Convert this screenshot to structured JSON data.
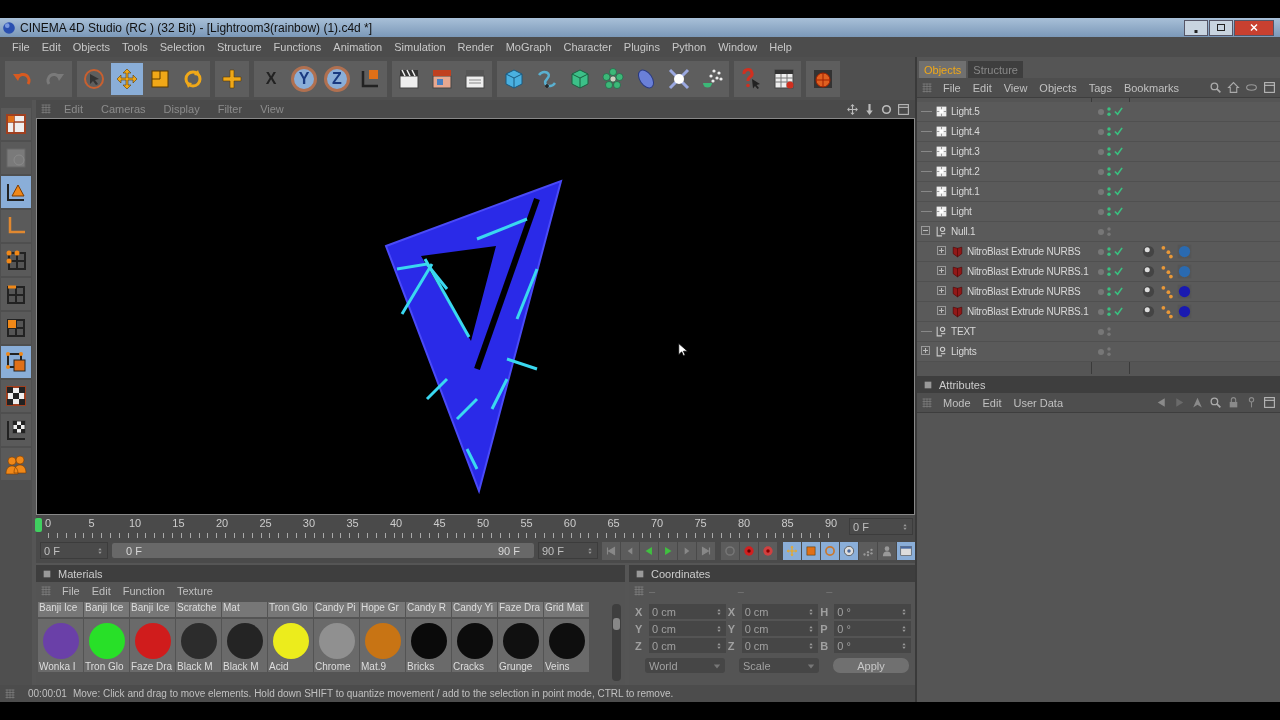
{
  "window": {
    "title": "CINEMA 4D Studio (RC ) (32 Bit) - [Lightroom3(rainbow) (1).c4d *]"
  },
  "menu_bar": [
    "File",
    "Edit",
    "Objects",
    "Tools",
    "Selection",
    "Structure",
    "Functions",
    "Animation",
    "Simulation",
    "Render",
    "MoGraph",
    "Character",
    "Plugins",
    "Python",
    "Window",
    "Help"
  ],
  "toolbar": [
    [
      {
        "kind": "undo",
        "selected": false
      },
      {
        "kind": "redo",
        "selected": false
      }
    ],
    [
      {
        "kind": "select",
        "selected": false
      },
      {
        "kind": "move",
        "selected": true
      },
      {
        "kind": "scale",
        "selected": false
      },
      {
        "kind": "rotate",
        "selected": false
      }
    ],
    [
      {
        "kind": "add",
        "selected": false
      }
    ],
    [
      {
        "kind": "axis",
        "label": "X",
        "selected": false
      },
      {
        "kind": "axis",
        "label": "Y",
        "selected": true
      },
      {
        "kind": "axis",
        "label": "Z",
        "selected": true
      },
      {
        "kind": "coord",
        "selected": false
      }
    ],
    [
      {
        "kind": "render-view",
        "selected": false
      },
      {
        "kind": "render",
        "selected": false
      },
      {
        "kind": "render-settings",
        "selected": false
      }
    ],
    [
      {
        "kind": "cube",
        "selected": false
      },
      {
        "kind": "spline",
        "selected": false
      },
      {
        "kind": "nurbs",
        "selected": false
      },
      {
        "kind": "array",
        "selected": false
      },
      {
        "kind": "deformer",
        "selected": false
      },
      {
        "kind": "scene",
        "selected": false
      },
      {
        "kind": "particles",
        "selected": false
      }
    ],
    [
      {
        "kind": "help",
        "selected": false
      },
      {
        "kind": "table",
        "selected": false
      }
    ],
    [
      {
        "kind": "sphere",
        "selected": false
      }
    ]
  ],
  "left_palette": [
    {
      "kind": "layout",
      "selected": false
    },
    {
      "kind": "texture",
      "selected": false
    },
    {
      "kind": "model",
      "selected": true
    },
    {
      "kind": "object-axis",
      "selected": false
    },
    {
      "kind": "points",
      "selected": false
    },
    {
      "kind": "edges",
      "selected": false
    },
    {
      "kind": "polygons",
      "selected": false
    },
    {
      "kind": "uv-polygons",
      "selected": true
    },
    {
      "kind": "checker",
      "selected": false
    },
    {
      "kind": "axis-checker",
      "selected": false
    },
    {
      "kind": "bodies",
      "selected": false
    }
  ],
  "viewport": {
    "menu": [
      "Edit",
      "Cameras",
      "Display",
      "Filter",
      "View"
    ]
  },
  "timeline": {
    "ticks": [
      "0",
      "5",
      "10",
      "15",
      "20",
      "25",
      "30",
      "35",
      "40",
      "45",
      "50",
      "55",
      "60",
      "65",
      "70",
      "75",
      "80",
      "85",
      "90"
    ],
    "current_frame": "0 F",
    "start": "0 F",
    "range": {
      "start": "0 F",
      "end": "90 F",
      "level": 1
    },
    "end": "90 F",
    "controls": [
      {
        "kind": "first",
        "selected": false
      },
      {
        "kind": "prev",
        "selected": false
      },
      {
        "kind": "play-back",
        "selected": false
      },
      {
        "kind": "play",
        "selected": false
      },
      {
        "kind": "next",
        "selected": false
      },
      {
        "kind": "last",
        "selected": false
      },
      {
        "kind": "key-off",
        "selected": false
      },
      {
        "kind": "record",
        "selected": false
      },
      {
        "kind": "autokey",
        "selected": false
      },
      {
        "kind": "key-move",
        "selected": true
      },
      {
        "kind": "key-scale",
        "selected": true
      },
      {
        "kind": "key-rotate",
        "selected": true
      },
      {
        "kind": "key-param",
        "selected": true
      },
      {
        "kind": "point-level",
        "selected": false
      },
      {
        "kind": "pla",
        "selected": false
      },
      {
        "kind": "scheme",
        "selected": true
      }
    ]
  },
  "materials": {
    "title": "Materials",
    "menu": [
      "File",
      "Edit",
      "Function",
      "Texture"
    ],
    "top_labels": [
      "Banji Ice",
      "Banji Ice",
      "Banji Ice",
      "Scratche",
      "Mat",
      "Tron Glo",
      "Candy Pi",
      "Hope Gr",
      "Candy R",
      "Candy Yi",
      "Faze Dra",
      "Grid Mat"
    ],
    "items": [
      {
        "name": "Wonka I",
        "color": "#6a40a8"
      },
      {
        "name": "Tron Glo",
        "color": "#28e028"
      },
      {
        "name": "Faze Dra",
        "color": "#d01c1c"
      },
      {
        "name": "Black M",
        "color": "#2c2c2c"
      },
      {
        "name": "Black M",
        "color": "#242424"
      },
      {
        "name": "Acid",
        "color": "#ecec1c"
      },
      {
        "name": "Chrome",
        "color": "#909090"
      },
      {
        "name": "Mat.9",
        "color": "#c87414"
      },
      {
        "name": "Bricks",
        "color": "#0a0a0a"
      },
      {
        "name": "Cracks",
        "color": "#0c0c0c"
      },
      {
        "name": "Grunge",
        "color": "#101010"
      },
      {
        "name": "Veins",
        "color": "#0e0e0e"
      }
    ]
  },
  "coordinates": {
    "title": "Coordinates",
    "menu": [
      "–",
      "–",
      "–"
    ],
    "disabled": true,
    "rows": [
      {
        "position_axis": "X",
        "position": "0 cm",
        "size_axis": "X",
        "size": "0 cm",
        "rotation_axis": "H",
        "rotation": "0 °"
      },
      {
        "position_axis": "Y",
        "position": "0 cm",
        "size_axis": "Y",
        "size": "0 cm",
        "rotation_axis": "P",
        "rotation": "0 °"
      },
      {
        "position_axis": "Z",
        "position": "0 cm",
        "size_axis": "Z",
        "size": "0 cm",
        "rotation_axis": "B",
        "rotation": "0 °"
      }
    ],
    "dropdowns": [
      "World",
      "Scale"
    ],
    "apply": "Apply"
  },
  "status_bar": {
    "time": "00:00:01",
    "message": "Move: Click and drag to move elements. Hold down SHIFT to quantize movement / add to the selection in point mode, CTRL to remove."
  },
  "objects": {
    "tabs": [
      {
        "label": "Objects",
        "selected": true
      },
      {
        "label": "Structure",
        "selected": false
      }
    ],
    "menu": [
      "File",
      "Edit",
      "View",
      "Objects",
      "Tags",
      "Bookmarks"
    ],
    "tree": [
      {
        "name": "Light.5",
        "kind": "light",
        "enabled": true
      },
      {
        "name": "Light.4",
        "kind": "light",
        "enabled": true
      },
      {
        "name": "Light.3",
        "kind": "light",
        "enabled": true
      },
      {
        "name": "Light.2",
        "kind": "light",
        "enabled": true
      },
      {
        "name": "Light.1",
        "kind": "light",
        "enabled": true
      },
      {
        "name": "Light",
        "kind": "light",
        "enabled": true
      },
      {
        "name": "Null.1",
        "kind": "null",
        "enabled": false,
        "expanded": true,
        "children": [
          {
            "name": "NitroBlast Extrude NURBS",
            "kind": "extrude",
            "enabled": true,
            "expanded": false,
            "tags": [
              {
                "kind": "phong"
              },
              {
                "kind": "points"
              },
              {
                "kind": "material",
                "color": "#2a6ab0"
              }
            ]
          },
          {
            "name": "NitroBlast Extrude NURBS.1",
            "kind": "extrude",
            "enabled": true,
            "expanded": false,
            "tags": [
              {
                "kind": "phong"
              },
              {
                "kind": "points"
              },
              {
                "kind": "material",
                "color": "#2a6ab0"
              }
            ]
          },
          {
            "name": "NitroBlast Extrude NURBS",
            "kind": "extrude",
            "enabled": true,
            "expanded": false,
            "tags": [
              {
                "kind": "phong"
              },
              {
                "kind": "points"
              },
              {
                "kind": "material",
                "color": "#1a1ab0"
              }
            ]
          },
          {
            "name": "NitroBlast Extrude NURBS.1",
            "kind": "extrude",
            "enabled": true,
            "expanded": false,
            "tags": [
              {
                "kind": "phong"
              },
              {
                "kind": "points"
              },
              {
                "kind": "material",
                "color": "#1a1ab0"
              }
            ]
          }
        ]
      },
      {
        "name": "TEXT",
        "kind": "null",
        "enabled": false
      },
      {
        "name": "Lights",
        "kind": "null",
        "enabled": false,
        "expanded": false
      }
    ]
  },
  "attributes": {
    "title": "Attributes",
    "menu": [
      "Mode",
      "Edit",
      "User Data"
    ]
  }
}
